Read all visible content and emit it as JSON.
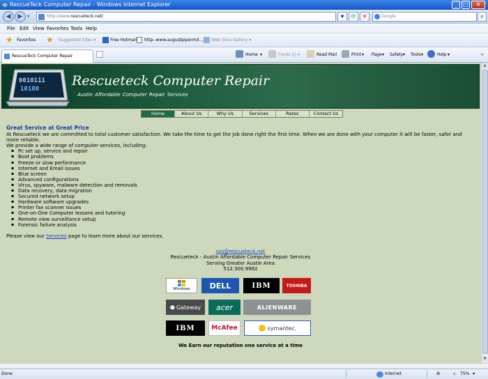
{
  "window": {
    "title": "RescueTeck Computer Repair - Windows Internet Explorer"
  },
  "address_bar": {
    "url_protocol": "http://www.",
    "url_domain": "rescueteck.net/",
    "search_placeholder": "Google"
  },
  "menu": [
    "File",
    "Edit",
    "View",
    "Favorites",
    "Tools",
    "Help"
  ],
  "favorites_bar": {
    "favorites_label": "Favorites",
    "items": [
      "Suggested Sites ▾",
      "Free Hotmail",
      "http--www.augustpipermd....",
      "Web Slice Gallery ▾"
    ]
  },
  "command_bar": {
    "tab_title": "RescueTeck Computer Repair",
    "items": [
      "Home",
      "Feeds (J)",
      "Read Mail",
      "Print",
      "Page",
      "Safety",
      "Tools",
      "Help"
    ]
  },
  "site": {
    "banner_title": "Rescueteck Computer Repair",
    "banner_subtitle": "Austin Affordable Computer Repair Services",
    "nav": [
      "Home",
      "About Us",
      "Why Us",
      "Services",
      "Rates",
      "Contact Us"
    ],
    "heading": "Great Service at Great Price",
    "intro": "At Rescueteck we are committed to total customer satisfaction. We take the time to get the job done right the first time. When we are done with your computer it will be faster, safer and more reliable.",
    "services_intro": "We provide a wide range of computer services, including:",
    "services": [
      "Pc set up, service and repair",
      "Boot problems",
      "Freeze or slow performance",
      "Internet and Email issues",
      "Blue screen",
      "Advanced configurations",
      "Virus, spyware, malware detection and removals",
      "Data recovery, data migration",
      "Secured network setup",
      "Hardware software upgrades",
      "Printer fax scanner issues",
      "One-on-One Computer lessons and tutoring",
      "Remote view surveillance setup",
      "Forensic failure analysis"
    ],
    "view_prefix": "Please view our ",
    "view_link": "Services",
    "view_suffix": " page to learn more about our services.",
    "email": "sos@rescueteck.net",
    "company_line": "Rescueteck - Austin Affordable Computer Repair Services",
    "service_area": "Serving Greater Austin Area",
    "phone": "512.300.9982",
    "brands": [
      "Windows",
      "DELL",
      "IBM",
      "TOSHIBA",
      "Gateway",
      "acer",
      "ALIENWARE",
      "IBM",
      "McAfee",
      "symantec."
    ],
    "motto": "We Earn our reputation one service at a time"
  },
  "status_bar": {
    "status": "Done",
    "zone": "Internet",
    "zoom": "75%"
  },
  "colors": {
    "page_bg": "#cdd8bd",
    "banner": "#1e5c3e",
    "nav_active": "#1f6b46",
    "heading": "#1d3d96",
    "link": "#1a3fbf"
  }
}
